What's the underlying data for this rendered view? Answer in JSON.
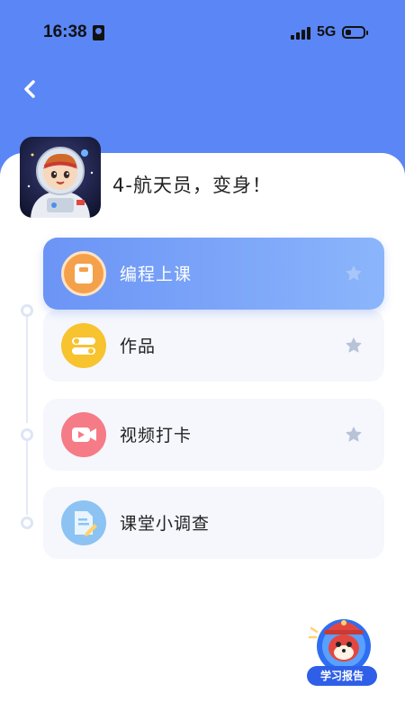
{
  "status_bar": {
    "time": "16:38",
    "network": "5G"
  },
  "header": {
    "back_icon": "chevron-left-icon"
  },
  "lesson": {
    "title": "4-航天员，变身！",
    "cover": "astronaut-avatar"
  },
  "menu": [
    {
      "label": "编程上课",
      "icon": "tablet-icon",
      "icon_color": "#f5a04a",
      "active": true
    },
    {
      "label": "作品",
      "icon": "toggle-icon",
      "icon_color": "#f7c32e",
      "active": false
    },
    {
      "label": "视频打卡",
      "icon": "video-camera-icon",
      "icon_color": "#f57b86",
      "active": false
    },
    {
      "label": "课堂小调查",
      "icon": "survey-icon",
      "icon_color": "#8cc3f3",
      "active": false
    }
  ],
  "report": {
    "label": "学习报告",
    "icon": "mascot-icon"
  },
  "colors": {
    "header_bg": "#5b86f5",
    "active_card": "#7aa5f9",
    "card_bg": "#f5f7fc"
  }
}
